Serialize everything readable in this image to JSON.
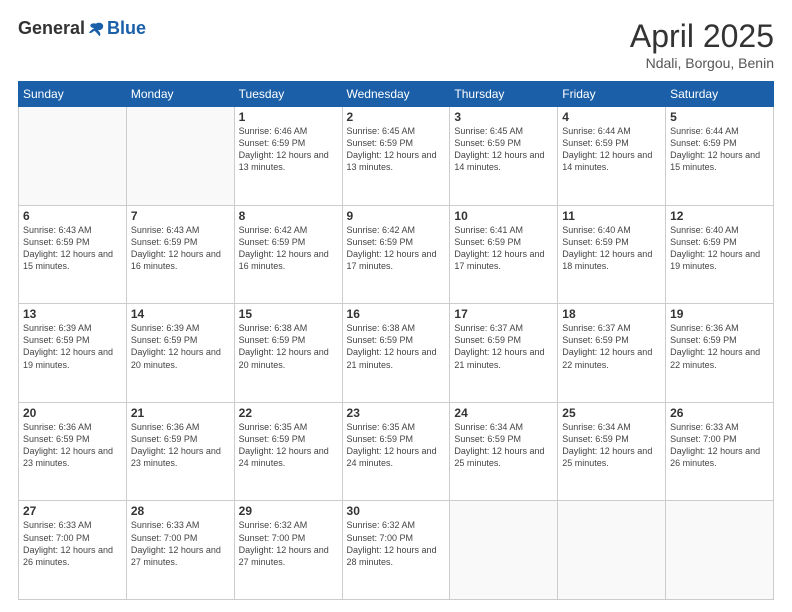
{
  "header": {
    "logo_general": "General",
    "logo_blue": "Blue",
    "title": "April 2025",
    "location": "Ndali, Borgou, Benin"
  },
  "days_of_week": [
    "Sunday",
    "Monday",
    "Tuesday",
    "Wednesday",
    "Thursday",
    "Friday",
    "Saturday"
  ],
  "weeks": [
    [
      {
        "day": "",
        "info": ""
      },
      {
        "day": "",
        "info": ""
      },
      {
        "day": "1",
        "info": "Sunrise: 6:46 AM\nSunset: 6:59 PM\nDaylight: 12 hours and 13 minutes."
      },
      {
        "day": "2",
        "info": "Sunrise: 6:45 AM\nSunset: 6:59 PM\nDaylight: 12 hours and 13 minutes."
      },
      {
        "day": "3",
        "info": "Sunrise: 6:45 AM\nSunset: 6:59 PM\nDaylight: 12 hours and 14 minutes."
      },
      {
        "day": "4",
        "info": "Sunrise: 6:44 AM\nSunset: 6:59 PM\nDaylight: 12 hours and 14 minutes."
      },
      {
        "day": "5",
        "info": "Sunrise: 6:44 AM\nSunset: 6:59 PM\nDaylight: 12 hours and 15 minutes."
      }
    ],
    [
      {
        "day": "6",
        "info": "Sunrise: 6:43 AM\nSunset: 6:59 PM\nDaylight: 12 hours and 15 minutes."
      },
      {
        "day": "7",
        "info": "Sunrise: 6:43 AM\nSunset: 6:59 PM\nDaylight: 12 hours and 16 minutes."
      },
      {
        "day": "8",
        "info": "Sunrise: 6:42 AM\nSunset: 6:59 PM\nDaylight: 12 hours and 16 minutes."
      },
      {
        "day": "9",
        "info": "Sunrise: 6:42 AM\nSunset: 6:59 PM\nDaylight: 12 hours and 17 minutes."
      },
      {
        "day": "10",
        "info": "Sunrise: 6:41 AM\nSunset: 6:59 PM\nDaylight: 12 hours and 17 minutes."
      },
      {
        "day": "11",
        "info": "Sunrise: 6:40 AM\nSunset: 6:59 PM\nDaylight: 12 hours and 18 minutes."
      },
      {
        "day": "12",
        "info": "Sunrise: 6:40 AM\nSunset: 6:59 PM\nDaylight: 12 hours and 19 minutes."
      }
    ],
    [
      {
        "day": "13",
        "info": "Sunrise: 6:39 AM\nSunset: 6:59 PM\nDaylight: 12 hours and 19 minutes."
      },
      {
        "day": "14",
        "info": "Sunrise: 6:39 AM\nSunset: 6:59 PM\nDaylight: 12 hours and 20 minutes."
      },
      {
        "day": "15",
        "info": "Sunrise: 6:38 AM\nSunset: 6:59 PM\nDaylight: 12 hours and 20 minutes."
      },
      {
        "day": "16",
        "info": "Sunrise: 6:38 AM\nSunset: 6:59 PM\nDaylight: 12 hours and 21 minutes."
      },
      {
        "day": "17",
        "info": "Sunrise: 6:37 AM\nSunset: 6:59 PM\nDaylight: 12 hours and 21 minutes."
      },
      {
        "day": "18",
        "info": "Sunrise: 6:37 AM\nSunset: 6:59 PM\nDaylight: 12 hours and 22 minutes."
      },
      {
        "day": "19",
        "info": "Sunrise: 6:36 AM\nSunset: 6:59 PM\nDaylight: 12 hours and 22 minutes."
      }
    ],
    [
      {
        "day": "20",
        "info": "Sunrise: 6:36 AM\nSunset: 6:59 PM\nDaylight: 12 hours and 23 minutes."
      },
      {
        "day": "21",
        "info": "Sunrise: 6:36 AM\nSunset: 6:59 PM\nDaylight: 12 hours and 23 minutes."
      },
      {
        "day": "22",
        "info": "Sunrise: 6:35 AM\nSunset: 6:59 PM\nDaylight: 12 hours and 24 minutes."
      },
      {
        "day": "23",
        "info": "Sunrise: 6:35 AM\nSunset: 6:59 PM\nDaylight: 12 hours and 24 minutes."
      },
      {
        "day": "24",
        "info": "Sunrise: 6:34 AM\nSunset: 6:59 PM\nDaylight: 12 hours and 25 minutes."
      },
      {
        "day": "25",
        "info": "Sunrise: 6:34 AM\nSunset: 6:59 PM\nDaylight: 12 hours and 25 minutes."
      },
      {
        "day": "26",
        "info": "Sunrise: 6:33 AM\nSunset: 7:00 PM\nDaylight: 12 hours and 26 minutes."
      }
    ],
    [
      {
        "day": "27",
        "info": "Sunrise: 6:33 AM\nSunset: 7:00 PM\nDaylight: 12 hours and 26 minutes."
      },
      {
        "day": "28",
        "info": "Sunrise: 6:33 AM\nSunset: 7:00 PM\nDaylight: 12 hours and 27 minutes."
      },
      {
        "day": "29",
        "info": "Sunrise: 6:32 AM\nSunset: 7:00 PM\nDaylight: 12 hours and 27 minutes."
      },
      {
        "day": "30",
        "info": "Sunrise: 6:32 AM\nSunset: 7:00 PM\nDaylight: 12 hours and 28 minutes."
      },
      {
        "day": "",
        "info": ""
      },
      {
        "day": "",
        "info": ""
      },
      {
        "day": "",
        "info": ""
      }
    ]
  ]
}
